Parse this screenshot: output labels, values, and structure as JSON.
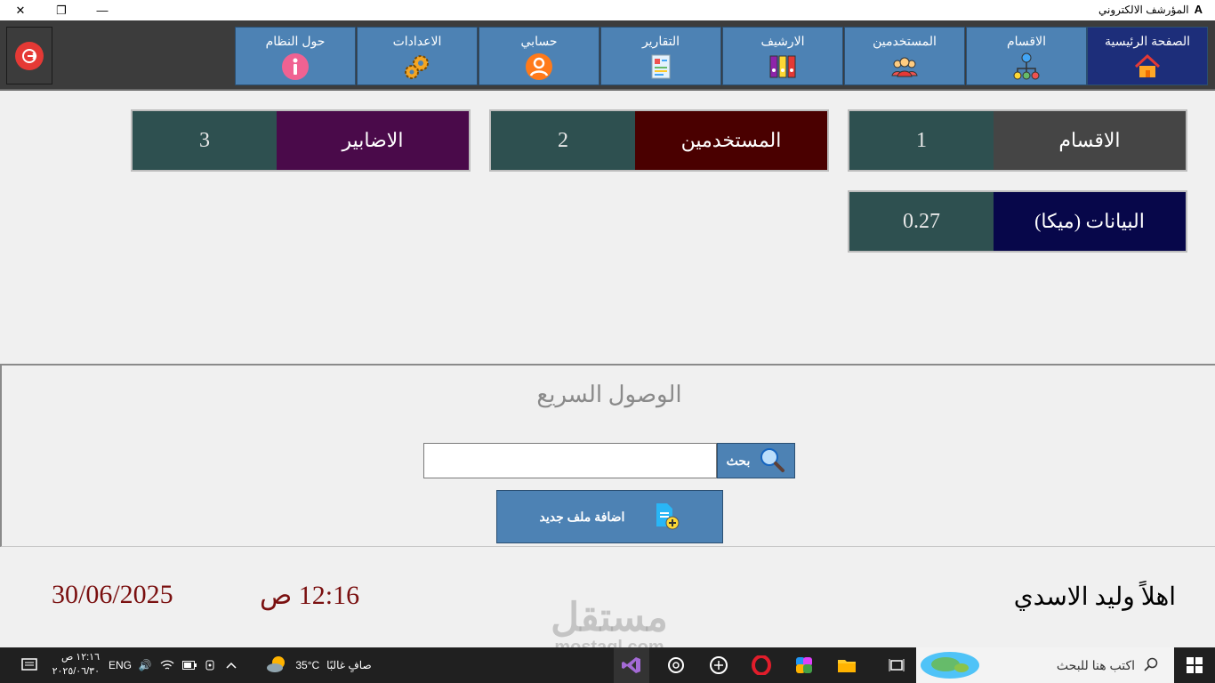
{
  "window": {
    "title": "المؤرشف الالكتروني",
    "logo": "A",
    "controls": {
      "close": "✕",
      "restore": "❐",
      "minimize": "—"
    }
  },
  "nav": {
    "items": [
      {
        "label": "الصفحة الرئيسية",
        "icon": "home-icon",
        "active": true
      },
      {
        "label": "الاقسام",
        "icon": "org-chart-icon"
      },
      {
        "label": "المستخدمين",
        "icon": "users-icon"
      },
      {
        "label": "الارشيف",
        "icon": "binders-icon"
      },
      {
        "label": "التقارير",
        "icon": "report-icon"
      },
      {
        "label": "حسابي",
        "icon": "account-icon"
      },
      {
        "label": "الاعدادات",
        "icon": "gears-icon"
      },
      {
        "label": "حول النظام",
        "icon": "info-icon"
      }
    ],
    "exit_icon": "logout-icon"
  },
  "stats": {
    "departments": {
      "label": "الاقسام",
      "value": "1",
      "color": "#454545"
    },
    "users": {
      "label": "المستخدمين",
      "value": "2",
      "color": "#4a0000"
    },
    "folders": {
      "label": "الاضابير",
      "value": "3",
      "color": "#4a0a4a"
    },
    "data": {
      "label": "البيانات (ميكا)",
      "value": "0.27",
      "color": "#07074a"
    }
  },
  "quick_access": {
    "title": "الوصول السريع",
    "search_placeholder": "",
    "search_label": "بحث",
    "add_label": "اضافة ملف جديد"
  },
  "footer": {
    "date": "30/06/2025",
    "time": "12:16 ص",
    "welcome": "اهلاً  وليد الاسدي"
  },
  "watermark": {
    "ar": "مستقل",
    "en": "mostaql.com"
  },
  "taskbar": {
    "search_placeholder": "اكتب هنا للبحث",
    "weather_temp": "35°C",
    "weather_text": "صافٍ غالبًا",
    "lang": "ENG",
    "clock_time": "١٢:١٦ ص",
    "clock_date": "٢٠٢٥/٠٦/٣٠"
  },
  "colors": {
    "accent": "#4d82b4",
    "active": "#1d2e7a",
    "value_bg": "#2e5050",
    "footer_text": "#7a1010"
  }
}
